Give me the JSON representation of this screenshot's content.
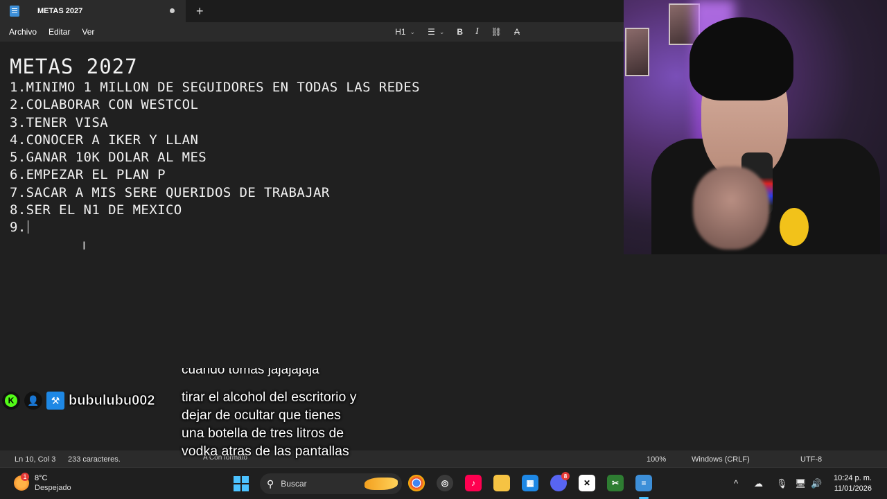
{
  "notepad": {
    "tab_title": "METAS 2027",
    "new_tab_label": "+",
    "menu": [
      "Archivo",
      "Editar",
      "Ver"
    ],
    "toolbar": {
      "heading": "H1"
    },
    "document": {
      "heading": "METAS 2027",
      "lines": [
        "1.MINIMO 1 MILLON DE SEGUIDORES EN TODAS LAS REDES",
        "2.COLABORAR CON WESTCOL",
        "3.TENER VISA",
        "4.CONOCER A IKER Y LLAN",
        "5.GANAR 10K DOLAR AL MES",
        "6.EMPEZAR EL PLAN P",
        "7.SACAR A MIS SERE QUERIDOS DE TRABAJAR",
        "8.SER EL N1 DE MEXICO",
        "9."
      ]
    },
    "status": {
      "position": "Ln 10, Col 3",
      "chars": "233 caracteres.",
      "format": "Con formato",
      "zoom": "100%",
      "line_endings": "Windows (CRLF)",
      "encoding": "UTF-8"
    }
  },
  "chat": {
    "username": "bubulubu002",
    "previous_fragment": "cuando tomas jajajajaja",
    "message": "tirar el alcohol del escritorio y dejar de ocultar que tienes una botella de tres litros de vodka atras de las pantallas"
  },
  "taskbar": {
    "weather_alert": "1",
    "temperature": "8°C",
    "weather_desc": "Despejado",
    "search_placeholder": "Buscar",
    "discord_badge": "8",
    "time": "10:24 p. m.",
    "date": "11/01/2026"
  },
  "colors": {
    "editor_bg": "#202020",
    "kick_green": "#53fc18",
    "accent": "#4cc2ff"
  }
}
